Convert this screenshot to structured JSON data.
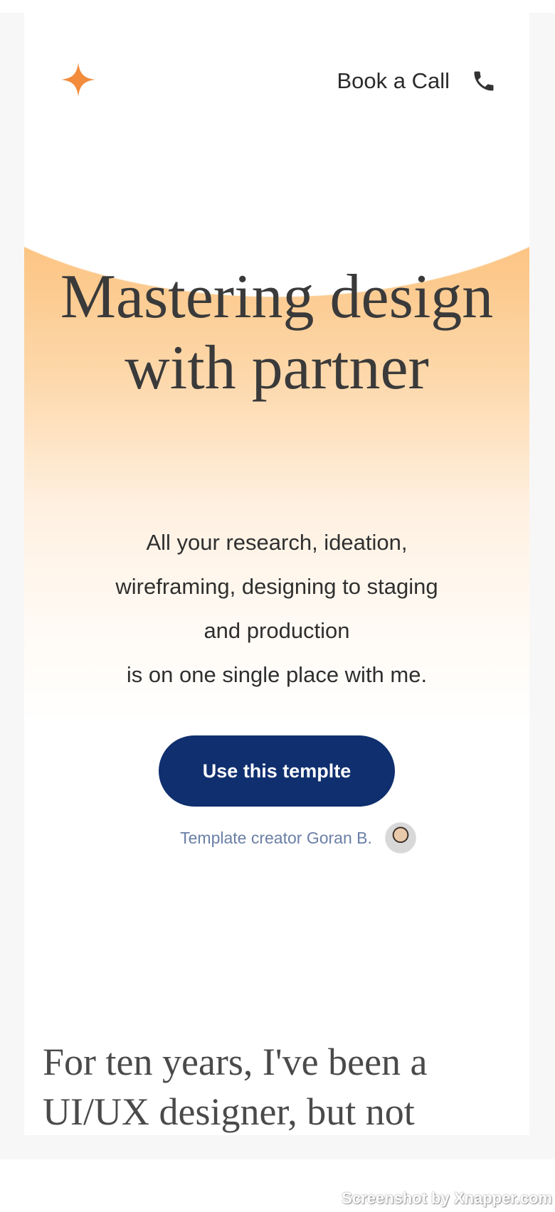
{
  "header": {
    "logo_icon": "sparkle-icon",
    "book_call_label": "Book a Call",
    "phone_icon": "phone-icon"
  },
  "hero": {
    "title": "Mastering design with partner",
    "subtitle_lines": [
      "All your research, ideation,",
      "wireframing, designing to staging",
      "and production",
      "is on one single place with me."
    ],
    "cta_label": "Use this templte",
    "creator_label": "Template creator Goran B."
  },
  "about": {
    "text": "For ten years, I've been a UI/UX designer, but not"
  },
  "watermark": "Screenshot by Xnapper.com",
  "colors": {
    "accent": "#f28b3c",
    "cta_background": "#0f2f6e",
    "creator_text": "#6a7fa6"
  }
}
